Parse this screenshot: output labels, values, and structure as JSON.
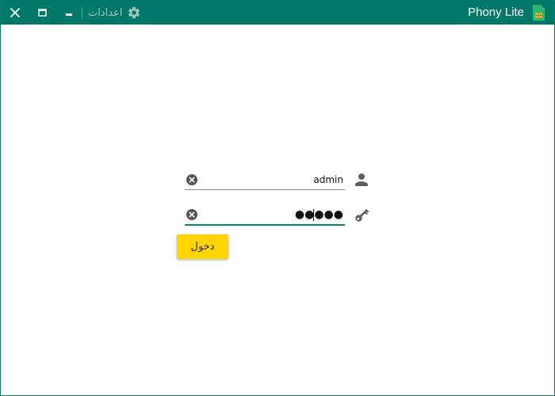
{
  "titlebar": {
    "app_title": "Phony Lite",
    "settings_label": "اعدادات",
    "icons": {
      "close": "close-icon",
      "maximize": "maximize-icon",
      "minimize": "minimize-icon",
      "settings": "gear-icon",
      "logo": "sim-card-icon"
    },
    "colors": {
      "background": "#00796b",
      "settings_text": "#9fc7c0"
    }
  },
  "login": {
    "username": {
      "value": "admin",
      "icon": "user-icon",
      "clear_icon": "clear-icon"
    },
    "password": {
      "value": "●●●●●",
      "icon": "key-icon",
      "clear_icon": "clear-icon"
    },
    "submit_label": "دخول",
    "colors": {
      "button": "#ffd400",
      "focus_underline": "#00897b"
    }
  }
}
